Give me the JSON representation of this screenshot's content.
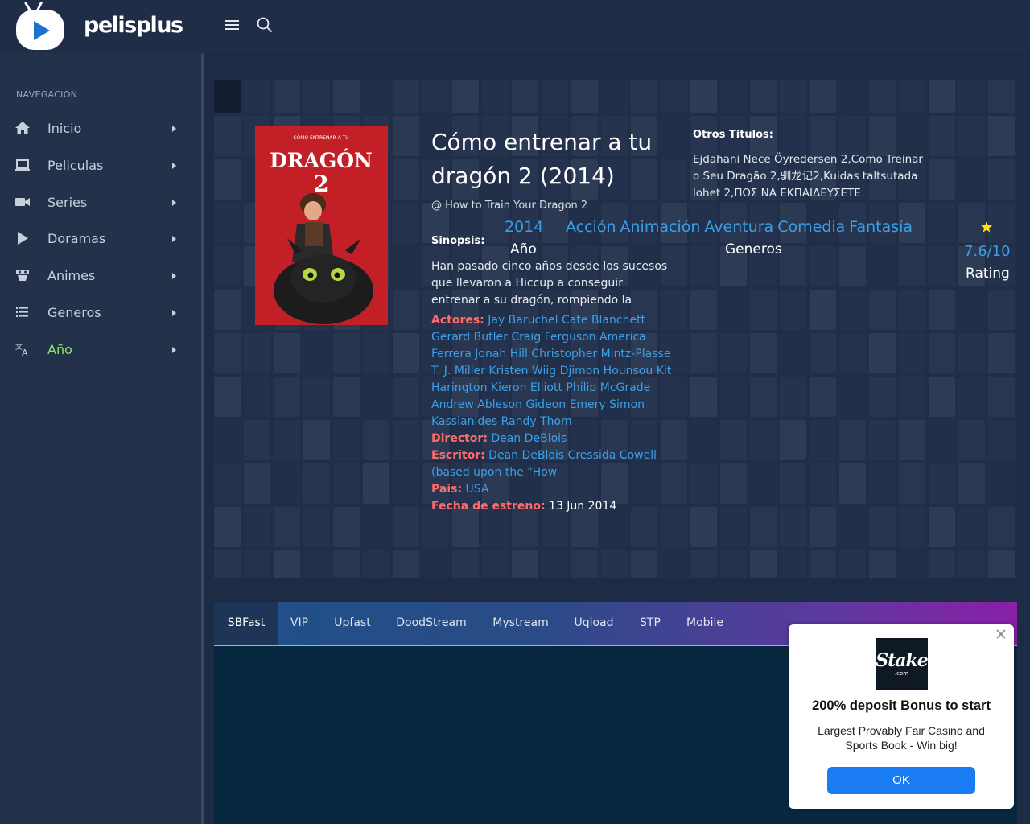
{
  "brand": {
    "name": "pelisplus"
  },
  "sidebar": {
    "heading": "NAVEGACION",
    "items": [
      {
        "label": "Inicio",
        "icon": "home-icon"
      },
      {
        "label": "Peliculas",
        "icon": "laptop-icon"
      },
      {
        "label": "Series",
        "icon": "video-camera-icon"
      },
      {
        "label": "Doramas",
        "icon": "play-icon"
      },
      {
        "label": "Animes",
        "icon": "anime-mask-icon"
      },
      {
        "label": "Generos",
        "icon": "list-icon"
      },
      {
        "label": "Año",
        "icon": "translate-icon"
      }
    ]
  },
  "movie": {
    "poster": {
      "top_text": "CÓMO ENTRENAR A TU",
      "word": "DRAGÓN",
      "number": "2"
    },
    "title": "Cómo entrenar a tu dragón 2 (2014)",
    "original_title": "@ How to Train Your Dragon 2",
    "sinopsis_label": "Sinopsis:",
    "synopsis": "Han pasado cinco años desde los sucesos que llevaron a Hiccup a conseguir entrenar a su dragón, rompiendo la tradición de su tribu vikinga.",
    "year": "2014",
    "year_label": "Año",
    "genres": [
      "Acción",
      "Animación",
      "Aventura",
      "Comedia",
      "Fantasía"
    ],
    "genres_label": "Generos",
    "rating": "7.6/10",
    "rating_label": "Rating",
    "otros_label": "Otros Titulos:",
    "otros_titulos": "Ejdahani Nece Öyredersen 2,Como Treinar o Seu Dragão 2,驯龙记2,Kuidas taltsutada lohet 2,ΠΩΣ ΝΑ ΕΚΠΑΙΔΕΥΣΕΤΕ",
    "actores_label": "Actores:",
    "actores": "Jay Baruchel Cate Blanchett Gerard Butler Craig Ferguson America Ferrera Jonah Hill Christopher Mintz-Plasse T. J. Miller Kristen Wiig Djimon Hounsou Kit Harington Kieron Elliott Philip McGrade Andrew Ableson Gideon Emery Simon Kassianides Randy Thom",
    "director_label": "Director:",
    "director": "Dean DeBlois",
    "escritor_label": "Escritor:",
    "escritor": "Dean DeBlois Cressida Cowell (based upon the \"How",
    "pais_label": "Pais:",
    "pais": "USA",
    "fecha_label": "Fecha de estreno:",
    "fecha": "13 Jun 2014"
  },
  "player": {
    "tabs": [
      "SBFast",
      "VIP",
      "Upfast",
      "DoodStream",
      "Mystream",
      "Uqload",
      "STP",
      "Mobile"
    ],
    "active_tab": 0
  },
  "ad": {
    "logo_text": "Stake",
    "logo_sub": ".com",
    "title": "200% deposit Bonus to start",
    "text": "Largest Provably Fair Casino and Sports Book - Win big!",
    "button": "OK"
  },
  "colors": {
    "link": "#3aa0e8",
    "label_red": "#ff6b6b",
    "active_nav": "#8ee66a",
    "ad_button": "#1a7cf2"
  }
}
